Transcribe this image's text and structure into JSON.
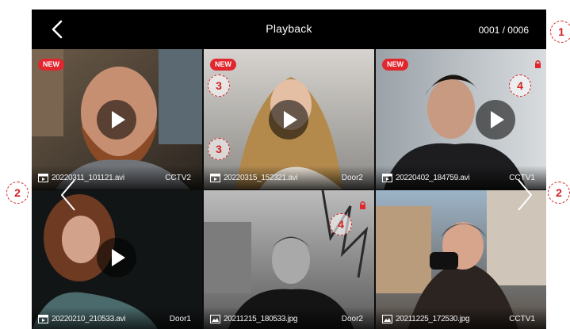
{
  "header": {
    "title": "Playback",
    "counter": "0001 / 0006"
  },
  "tiles": [
    {
      "file": "20220311_101121.avi",
      "camera": "CCTV2",
      "new": "NEW",
      "type": "video"
    },
    {
      "file": "20220315_152321.avi",
      "camera": "Door2",
      "new": "NEW",
      "type": "video"
    },
    {
      "file": "20220402_184759.avi",
      "camera": "CCTV1",
      "new": "NEW",
      "type": "video"
    },
    {
      "file": "20220210_210533.avi",
      "camera": "Door1",
      "type": "video"
    },
    {
      "file": "20211215_180533.jpg",
      "camera": "Door2",
      "type": "image"
    },
    {
      "file": "20211225_172530.jpg",
      "camera": "CCTV1",
      "type": "image"
    }
  ],
  "callouts": {
    "c1": "1",
    "c2_left": "2",
    "c2_right": "2",
    "c3_top": "3",
    "c3_bottom": "3",
    "c4_top": "4",
    "c4_bottom": "4"
  },
  "colors": {
    "new_badge": "#e2262e",
    "callout": "#d42020"
  },
  "icons": [
    "back-arrow-icon",
    "play-icon",
    "video-file-icon",
    "image-file-icon",
    "lock-icon",
    "chevron-left-icon",
    "chevron-right-icon"
  ]
}
